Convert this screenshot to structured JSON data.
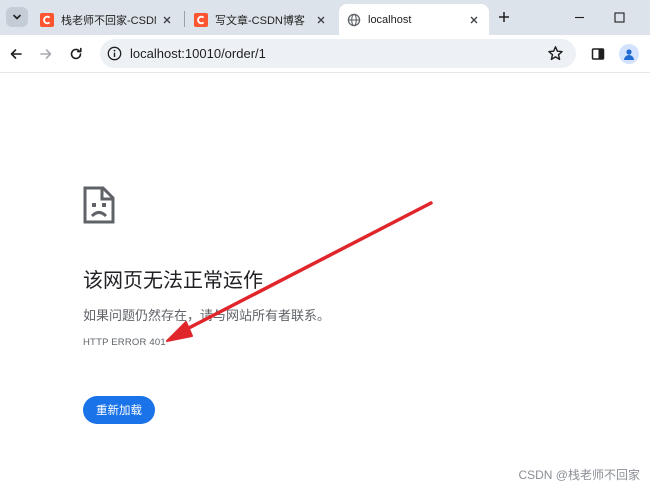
{
  "tabs": [
    {
      "title": "栈老师不回家-CSDN",
      "active": false,
      "favicon": "csdn-icon"
    },
    {
      "title": "写文章-CSDN博客",
      "active": false,
      "favicon": "csdn-icon"
    },
    {
      "title": "localhost",
      "active": true,
      "favicon": "globe-icon"
    }
  ],
  "address_bar": {
    "url": "localhost:10010/order/1"
  },
  "error_page": {
    "title": "该网页无法正常运作",
    "description": "如果问题仍然存在，请与网站所有者联系。",
    "code": "HTTP ERROR 401",
    "reload_label": "重新加载"
  },
  "watermark": "CSDN @栈老师不回家",
  "colors": {
    "csdn": "#fc5531",
    "annotation_arrow": "#e0262b",
    "button": "#1a73e8",
    "tabstrip": "#dde3ea"
  }
}
